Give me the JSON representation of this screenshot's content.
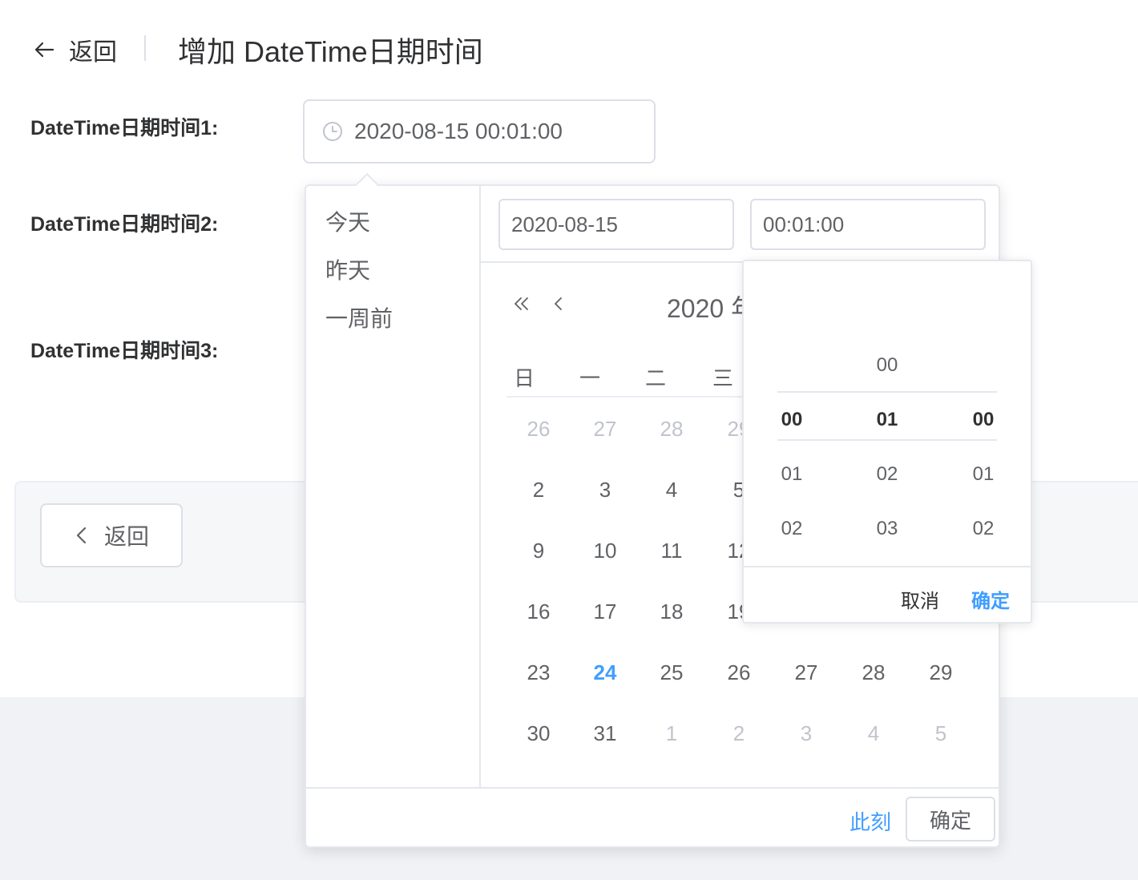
{
  "header": {
    "back_label": "返回",
    "title": "增加 DateTime日期时间"
  },
  "form": {
    "label1": "DateTime日期时间1:",
    "label2": "DateTime日期时间2:",
    "label3": "DateTime日期时间3:",
    "value1": "2020-08-15 00:01:00"
  },
  "footer": {
    "back_label": "返回"
  },
  "picker": {
    "shortcuts": [
      "今天",
      "昨天",
      "一周前"
    ],
    "date_value": "2020-08-15",
    "time_value": "00:01:00",
    "month_label": "2020 年",
    "weekdays": [
      "日",
      "一",
      "二",
      "三"
    ],
    "days": [
      [
        "26",
        "27",
        "28",
        "29"
      ],
      [
        "2",
        "3",
        "4",
        "5"
      ],
      [
        "9",
        "10",
        "11",
        "12"
      ],
      [
        "16",
        "17",
        "18",
        "19"
      ],
      [
        "23",
        "24",
        "25",
        "26",
        "27",
        "28",
        "29"
      ],
      [
        "30",
        "31",
        "1",
        "2",
        "3",
        "4",
        "5"
      ]
    ],
    "today": "24",
    "now_label": "此刻",
    "ok_label": "确定"
  },
  "time_spinner": {
    "hours": [
      "00",
      "01",
      "02"
    ],
    "minutes": [
      "00",
      "01",
      "02",
      "03"
    ],
    "seconds": [
      "00",
      "01",
      "02"
    ],
    "selected": {
      "hour": "00",
      "minute": "01",
      "second": "00"
    },
    "cancel_label": "取消",
    "ok_label": "确定"
  },
  "colors": {
    "accent": "#409eff",
    "text": "#303133",
    "muted": "#c0c4cc"
  }
}
